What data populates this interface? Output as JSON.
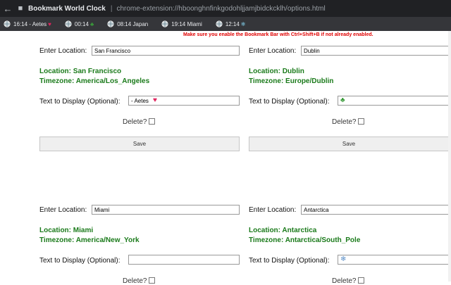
{
  "window": {
    "app_title": "Bookmark World Clock",
    "url": "chrome-extension://hboonghnfinkgodohljjamjbidckcklh/options.html"
  },
  "bookmarks": [
    {
      "label": "16:14 - Aetes",
      "emoji": "♥",
      "emoji_name": "heart-icon"
    },
    {
      "label": "00:14",
      "emoji": "♣",
      "emoji_name": "clover-icon"
    },
    {
      "label": "08:14 Japan",
      "emoji": "",
      "emoji_name": ""
    },
    {
      "label": "19:14 Miami",
      "emoji": "",
      "emoji_name": ""
    },
    {
      "label": "12:14",
      "emoji": "❄",
      "emoji_name": "snowflake-icon"
    }
  ],
  "warning": "Make sure you enable the Bookmark Bar with Ctrl+Shift+B if not already enabled.",
  "labels": {
    "enter_location": "Enter Location:",
    "text_to_display": "Text to Display (Optional):",
    "delete": "Delete?",
    "save": "Save",
    "location_prefix": "Location: ",
    "timezone_prefix": "Timezone: "
  },
  "locations": [
    {
      "location": "San Francisco",
      "timezone": "America/Los_Angeles",
      "display_text": "- Aetes",
      "display_emoji": "♥"
    },
    {
      "location": "Dublin",
      "timezone": "Europe/Dublin",
      "display_text": "",
      "display_emoji": "♣"
    },
    {
      "location": "Miami",
      "timezone": "America/New_York",
      "display_text": "",
      "display_emoji": ""
    },
    {
      "location": "Antarctica",
      "timezone": "Antarctica/South_Pole",
      "display_text": "",
      "display_emoji": "❄"
    }
  ],
  "colors": {
    "info_green": "#1a7a1a",
    "warning_red": "#e00000"
  }
}
